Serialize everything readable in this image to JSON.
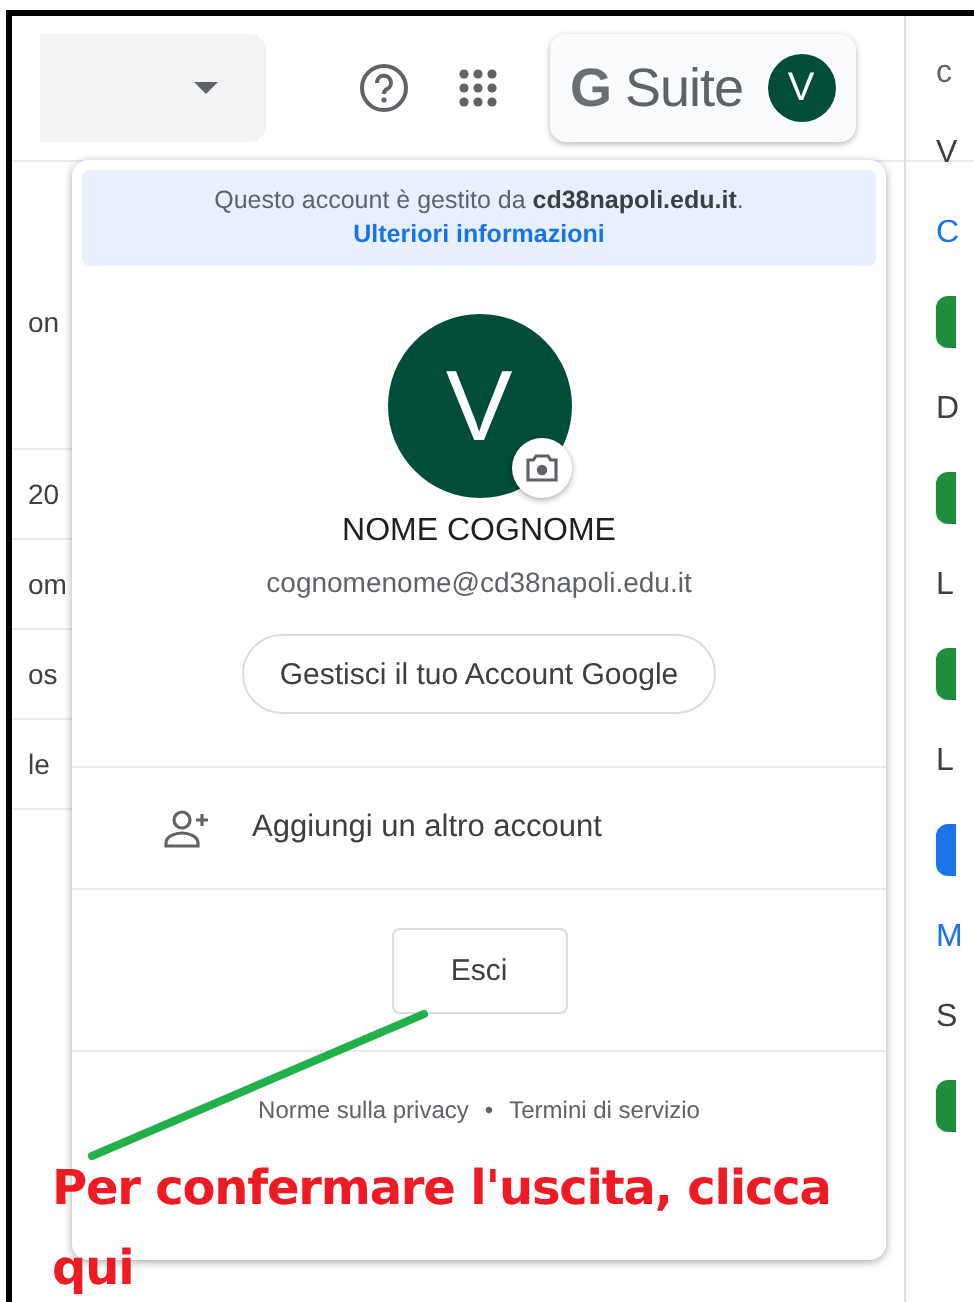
{
  "topbar": {
    "brand": "**G** Suite",
    "avatar_letter": "V"
  },
  "left_list": [
    "on",
    "20",
    "om",
    "os",
    "le"
  ],
  "right_column": [
    {
      "kind": "text",
      "text": "c",
      "color": "#5f6368"
    },
    {
      "kind": "text",
      "text": "V",
      "color": "#3c4043"
    },
    {
      "kind": "text",
      "text": "C",
      "color": "#1a73e8"
    },
    {
      "kind": "chip",
      "color": "#1e8e3e"
    },
    {
      "kind": "text",
      "text": "D",
      "color": "#3c4043"
    },
    {
      "kind": "chip",
      "color": "#1e8e3e"
    },
    {
      "kind": "text",
      "text": "L",
      "color": "#3c4043"
    },
    {
      "kind": "chip",
      "color": "#1e8e3e"
    },
    {
      "kind": "text",
      "text": "L",
      "color": "#3c4043"
    },
    {
      "kind": "chip",
      "color": "#1a73e8"
    },
    {
      "kind": "text",
      "text": "M",
      "color": "#1a73e8"
    },
    {
      "kind": "text",
      "text": "S",
      "color": "#3c4043"
    },
    {
      "kind": "chip",
      "color": "#1e8e3e"
    }
  ],
  "account_menu": {
    "banner": {
      "message": "Questo account è gestito da **cd38napoli.edu.it**.",
      "link": "Ulteriori informazioni"
    },
    "avatar_letter": "V",
    "name": "NOME COGNOME",
    "email": "cognomenome@cd38napoli.edu.it",
    "manage_button": "Gestisci il tuo Account Google",
    "add_account": "Aggiungi un altro account",
    "sign_out": "Esci",
    "footer": {
      "links": [
        "Norme sulla privacy",
        "Termini di servizio"
      ],
      "separator": "•"
    }
  },
  "annotation": {
    "text": "Per confermare l'uscita, clicca qui"
  }
}
